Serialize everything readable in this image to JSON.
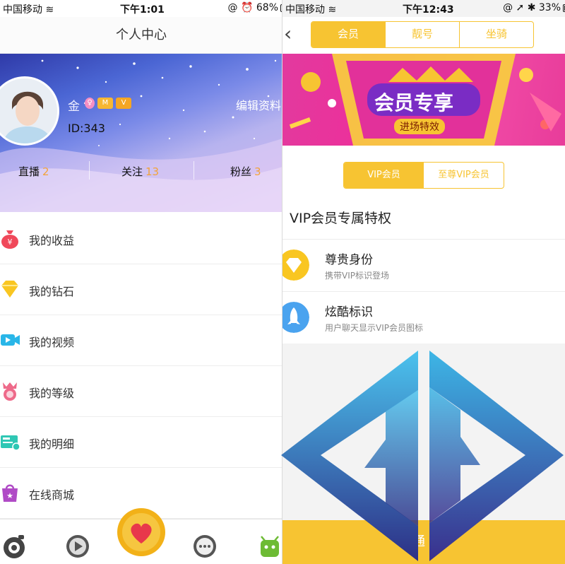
{
  "left": {
    "status": {
      "carrier": "中国移动",
      "time": "下午1:01",
      "battery": "68%"
    },
    "header_title": "个人中心",
    "profile": {
      "nickname": "金",
      "badge_1": "M",
      "badge_2": "V",
      "id_text": "ID:343",
      "edit_label": "编辑资料",
      "stats": [
        {
          "label": "直播",
          "count": "2"
        },
        {
          "label": "关注",
          "count": "13"
        },
        {
          "label": "粉丝",
          "count": "3"
        }
      ]
    },
    "menu": [
      {
        "label": "我的收益",
        "icon": "money-bag-icon",
        "color": "#f0485a"
      },
      {
        "label": "我的钻石",
        "icon": "diamond-icon",
        "color": "#f9c621"
      },
      {
        "label": "我的视频",
        "icon": "video-camera-icon",
        "color": "#29b6e8"
      },
      {
        "label": "我的等级",
        "icon": "crown-medal-icon",
        "color": "#ee6a8a"
      },
      {
        "label": "我的明细",
        "icon": "money-note-icon",
        "color": "#2fc7b4"
      },
      {
        "label": "在线商城",
        "icon": "shopping-bag-icon",
        "color": "#b04bc6"
      }
    ]
  },
  "right": {
    "status": {
      "carrier": "中国移动",
      "time": "下午12:43",
      "battery": "33%"
    },
    "tabs": [
      "会员",
      "靓号",
      "坐骑"
    ],
    "banner": {
      "title": "会员专享",
      "subtitle": "进场特效"
    },
    "vip_tabs": [
      "VIP会员",
      "至尊VIP会员"
    ],
    "section_title": "VIP会员专属特权",
    "privileges": [
      {
        "title": "尊贵身份",
        "subtitle": "携带VIP标识登场",
        "icon": "diamond-icon",
        "color": "#f9c621"
      },
      {
        "title": "炫酷标识",
        "subtitle": "用户聊天显示VIP会员图标",
        "icon": "rocket-icon",
        "color": "#4aa3ef"
      }
    ],
    "bottom_button": "开通"
  },
  "colors": {
    "accent": "#f7c432",
    "count": "#f2a33a",
    "banner_pink": "#ef2d9a"
  }
}
